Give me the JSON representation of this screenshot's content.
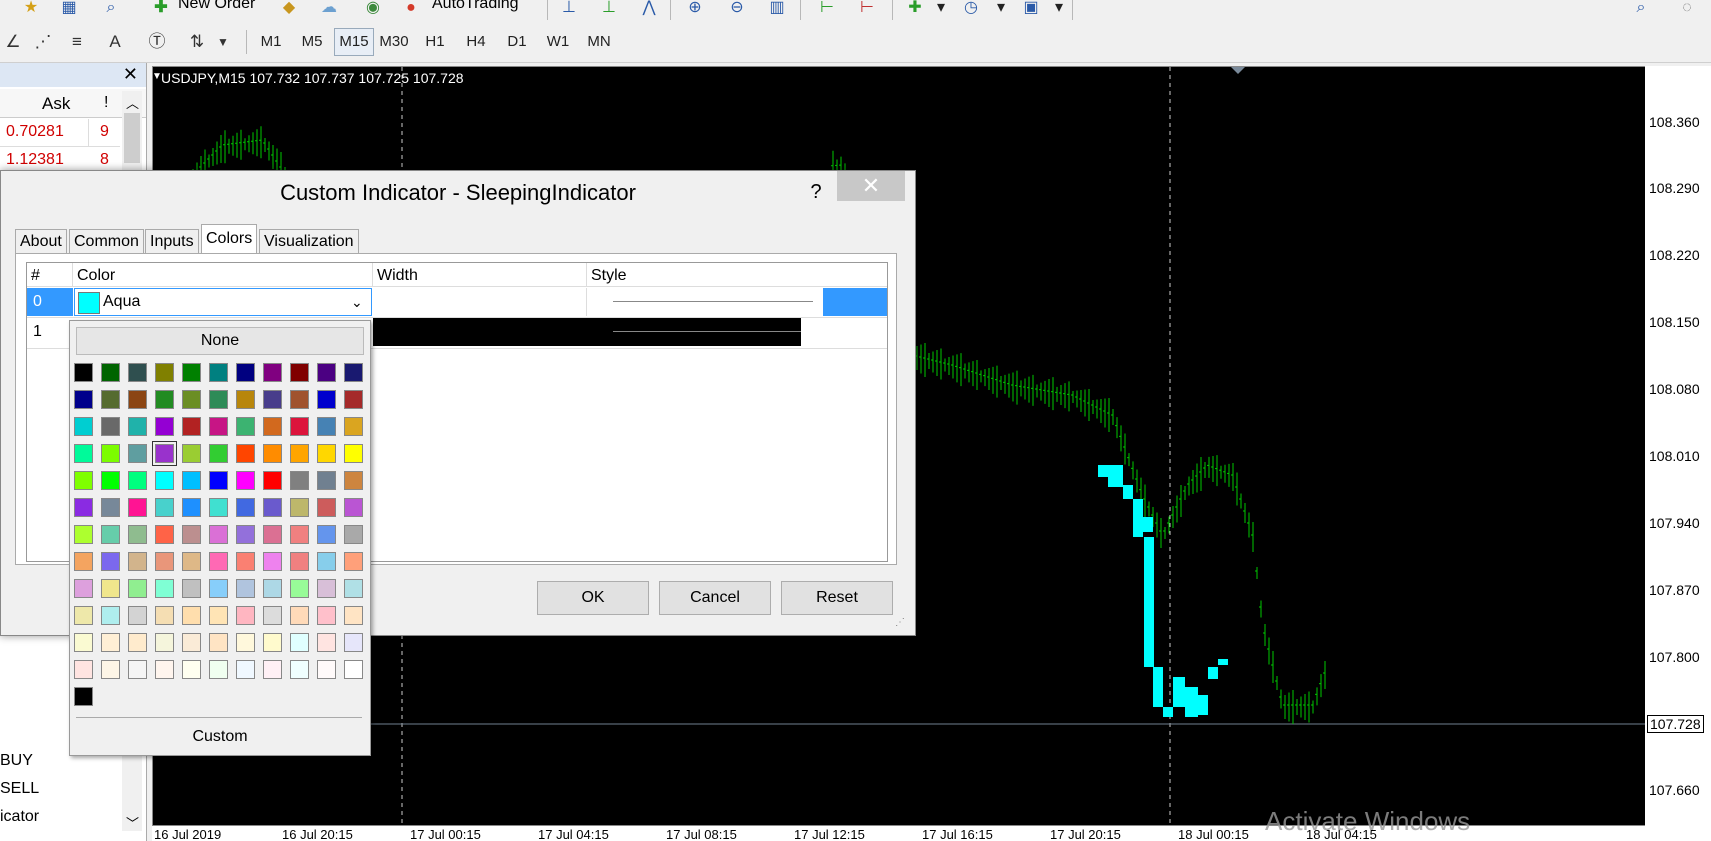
{
  "toolbar": {
    "new_order": "New Order",
    "auto_trading": "AutoTrading",
    "timeframes": [
      "M1",
      "M5",
      "M15",
      "M30",
      "H1",
      "H4",
      "D1",
      "W1",
      "MN"
    ],
    "selected_timeframe": "M15",
    "text_tool": "A"
  },
  "market_watch": {
    "col_ask": "Ask",
    "col_spread": "!",
    "rows": [
      {
        "ask": "0.70281",
        "spread": "9"
      },
      {
        "ask": "1.12381",
        "spread": "8"
      }
    ],
    "side_items": [
      "BUY",
      "SELL",
      "icator"
    ]
  },
  "chart": {
    "header": "USDJPY,M15  107.732 107.737 107.725 107.728",
    "price_labels": [
      "108.360",
      "108.290",
      "108.220",
      "108.150",
      "108.080",
      "108.010",
      "107.940",
      "107.870",
      "107.800",
      "107.728",
      "107.660"
    ],
    "current_price": "107.728",
    "time_labels": [
      "16 Jul 2019",
      "16 Jul 20:15",
      "17 Jul 00:15",
      "17 Jul 04:15",
      "17 Jul 08:15",
      "17 Jul 12:15",
      "17 Jul 16:15",
      "17 Jul 20:15",
      "18 Jul 00:15",
      "18 Jul 04:15"
    ],
    "watermark": "Activate Windows",
    "colors": {
      "bars": "#00c800",
      "indicator": "#00ffff",
      "bid_line": "#708090"
    }
  },
  "dialog": {
    "title": "Custom Indicator - SleepingIndicator",
    "help": "?",
    "tabs": [
      "About",
      "Common",
      "Inputs",
      "Colors",
      "Visualization"
    ],
    "active_tab": "Colors",
    "columns": {
      "num": "#",
      "color": "Color",
      "width": "Width",
      "style": "Style"
    },
    "rows": [
      {
        "num": "0",
        "color_name": "Aqua",
        "color_hex": "#00ffff"
      },
      {
        "num": "1",
        "color_name": "",
        "color_hex": "#000000"
      }
    ],
    "buttons": {
      "ok": "OK",
      "cancel": "Cancel",
      "reset": "Reset"
    }
  },
  "palette": {
    "none_label": "None",
    "custom_label": "Custom",
    "selected_index": 36,
    "swatches": [
      "#000000",
      "#006400",
      "#2f4f4f",
      "#808000",
      "#008000",
      "#008080",
      "#000080",
      "#800080",
      "#800000",
      "#4b0082",
      "#191970",
      "#00008b",
      "#556b2f",
      "#8b4513",
      "#228b22",
      "#6b8e23",
      "#2e8b57",
      "#b8860b",
      "#483d8b",
      "#a0522d",
      "#0000cd",
      "#a52a2a",
      "#00ced1",
      "#696969",
      "#20b2aa",
      "#9400d3",
      "#b22222",
      "#c71585",
      "#3cb371",
      "#d2691e",
      "#dc143c",
      "#4682b4",
      "#daa520",
      "#00fa9a",
      "#7cfc00",
      "#5f9ea0",
      "#9932cc",
      "#9acd32",
      "#32cd32",
      "#ff4500",
      "#ff8c00",
      "#ffa500",
      "#ffd700",
      "#ffff00",
      "#7fff00",
      "#00ff00",
      "#00ff7f",
      "#00ffff",
      "#00bfff",
      "#0000ff",
      "#ff00ff",
      "#ff0000",
      "#808080",
      "#708090",
      "#cd853f",
      "#8a2be2",
      "#778899",
      "#ff1493",
      "#48d1cc",
      "#1e90ff",
      "#40e0d0",
      "#4169e1",
      "#6a5acd",
      "#bdb76b",
      "#cd5c5c",
      "#ba55d3",
      "#adff2f",
      "#66cdaa",
      "#8fbc8f",
      "#ff6347",
      "#bc8f8f",
      "#da70d6",
      "#9370db",
      "#db7093",
      "#f08080",
      "#6495ed",
      "#a9a9a9",
      "#f4a460",
      "#7b68ee",
      "#d2b48c",
      "#e9967a",
      "#deb887",
      "#ff69b4",
      "#fa8072",
      "#ee82ee",
      "#f08080",
      "#87ceeb",
      "#ffa07a",
      "#dda0dd",
      "#f0e68c",
      "#90ee90",
      "#7fffd4",
      "#c0c0c0",
      "#87cefa",
      "#b0c4de",
      "#add8e6",
      "#98fb98",
      "#d8bfd8",
      "#b0e0e6",
      "#eee8aa",
      "#afeeee",
      "#d3d3d3",
      "#f5deb3",
      "#ffdead",
      "#ffe4b5",
      "#ffb6c1",
      "#dcdcdc",
      "#ffdab9",
      "#ffc0cb",
      "#ffe4c4",
      "#fafad2",
      "#ffefd5",
      "#ffebcd",
      "#f5f5dc",
      "#faebd7",
      "#ffe4c4",
      "#fff8dc",
      "#fffacd",
      "#e0ffff",
      "#ffe4e1",
      "#e6e6fa",
      "#ffe4e1",
      "#fdf5e6",
      "#f5f5f5",
      "#fff5ee",
      "#fffff0",
      "#f0fff0",
      "#f0f8ff",
      "#fff0f5",
      "#f0ffff",
      "#fffafa",
      "#ffffff",
      "#000000"
    ]
  }
}
